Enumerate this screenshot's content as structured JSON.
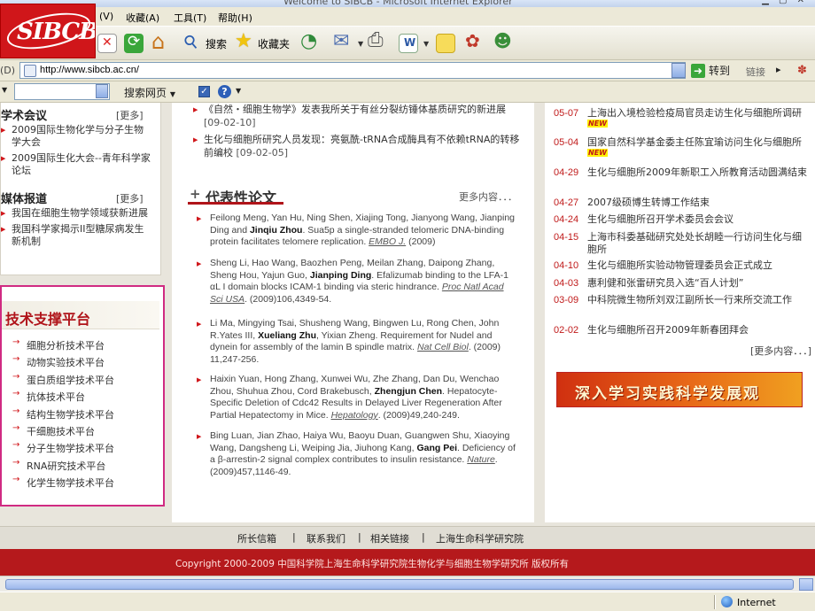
{
  "window": {
    "title": "Welcome to SIBCB - Microsoft Internet Explorer"
  },
  "logo": {
    "text": "SIBCB"
  },
  "menu": {
    "items": [
      "(V)",
      "收藏(A)",
      "工具(T)",
      "帮助(H)"
    ]
  },
  "toolbar": {
    "search_label": "搜索",
    "favorites_label": "收藏夹"
  },
  "address": {
    "label": "(D)",
    "url": "http://www.sibcb.ac.cn/",
    "go_label": "转到",
    "links_label": "链接"
  },
  "searchbar": {
    "search_web_label": "搜索网页"
  },
  "left": {
    "conf": {
      "title": "学术会议",
      "more": "[更多]",
      "items": [
        "2009国际生物化学与分子生物学大会",
        "2009国际生化大会--青年科学家论坛"
      ]
    },
    "media": {
      "title": "媒体报道",
      "more": "[更多]",
      "items": [
        "我国在细胞生物学领域获新进展",
        "我国科学家揭示II型糖尿病发生新机制"
      ]
    },
    "platform": {
      "title": "技术支撑平台",
      "items": [
        "细胞分析技术平台",
        "动物实验技术平台",
        "蛋白质组学技术平台",
        "抗体技术平台",
        "结构生物学技术平台",
        "干细胞技术平台",
        "分子生物学技术平台",
        "RNA研究技术平台",
        "化学生物学技术平台"
      ]
    }
  },
  "middle": {
    "news": [
      {
        "text": "《自然・细胞生物学》发表我所关于有丝分裂纺锤体基质研究的新进展",
        "date": "[09-02-10]"
      },
      {
        "text": "生化与细胞所研究人员发现：亮氨酰-tRNA合成酶具有不依赖tRNA的转移前编校",
        "date": "[09-02-05]"
      }
    ],
    "papers_title": "代表性论文",
    "papers_more": "更多内容．．．",
    "papers": [
      {
        "pre": "Feilong Meng, Yan Hu, Ning Shen, Xiajing Tong, Jianyong Wang, Jianping Ding and ",
        "bold": "Jinqiu Zhou",
        "post": ". Sua5p a single-stranded telomeric DNA-binding protein facilitates telomere replication. ",
        "journal": "EMBO J.",
        "tail": " (2009)"
      },
      {
        "pre": "Sheng Li, Hao Wang, Baozhen Peng, Meilan Zhang, Daipong Zhang, Sheng Hou, Yajun Guo, ",
        "bold": "Jianping Ding",
        "post": ". Efalizumab binding to the LFA-1 αL I domain blocks ICAM-1 binding via steric hindrance. ",
        "journal": "Proc Natl Acad Sci USA",
        "tail": ". (2009)106,4349-54."
      },
      {
        "pre": "Li Ma, Mingying Tsai, Shusheng Wang, Bingwen Lu, Rong Chen, John R.Yates III, ",
        "bold": "Xueliang Zhu",
        "post": ", Yixian Zheng. Requirement for Nudel and dynein for assembly of the lamin B spindle matrix. ",
        "journal": "Nat Cell Biol",
        "tail": ". (2009) 11,247-256."
      },
      {
        "pre": "Haixin Yuan, Hong Zhang, Xunwei Wu, Zhe Zhang, Dan Du, Wenchao Zhou, Shuhua Zhou, Cord Brakebusch, ",
        "bold": "Zhengjun Chen",
        "post": ". Hepatocyte-Specific Deletion of Cdc42 Results in Delayed Liver Regeneration After Partial Hepatectomy in Mice. ",
        "journal": "Hepatology",
        "tail": ". (2009)49,240-249."
      },
      {
        "pre": "Bing Luan, Jian Zhao, Haiya Wu, Baoyu Duan, Guangwen Shu, Xiaoying Wang, Dangsheng Li, Weiping Jia, Jiuhong Kang, ",
        "bold": "Gang Pei",
        "post": ". Deficiency of a β-arrestin-2 signal complex contributes to insulin resistance. ",
        "journal": "Nature",
        "tail": ". (2009)457,1146-49."
      }
    ]
  },
  "right": {
    "news": [
      {
        "date": "05-07",
        "text": "上海出入境检验检疫局官员走访生化与细胞所调研",
        "new": true
      },
      {
        "date": "05-04",
        "text": "国家自然科学基金委主任陈宜瑜访问生化与细胞所",
        "new": true
      },
      {
        "date": "04-29",
        "text": "生化与细胞所2009年新职工入所教育活动圆满结束",
        "new": false
      },
      {
        "date": "04-27",
        "text": "2007级硕博生转博工作结束",
        "new": false
      },
      {
        "date": "04-24",
        "text": "生化与细胞所召开学术委员会会议",
        "new": false
      },
      {
        "date": "04-15",
        "text": "上海市科委基础研究处处长胡睦一行访问生化与细胞所",
        "new": false
      },
      {
        "date": "04-10",
        "text": "生化与细胞所实验动物管理委员会正式成立",
        "new": false
      },
      {
        "date": "04-03",
        "text": "惠利健和张雷研究员入选“百人计划”",
        "new": false
      },
      {
        "date": "03-09",
        "text": "中科院微生物所刘双江副所长一行来所交流工作",
        "new": false
      },
      {
        "date": "02-02",
        "text": "生化与细胞所召开2009年新春团拜会",
        "new": false
      }
    ],
    "new_badge": "NEW",
    "more": "[更多内容．．．]",
    "banner": "深入学习实践科学发展观"
  },
  "footer": {
    "links": [
      "所长信箱",
      "|",
      "联系我们",
      "|",
      "相关链接",
      "|",
      "上海生命科学研究院"
    ],
    "copyright": "Copyright 2000-2009  中国科学院上海生命科学研究院生物化学与细胞生物学研究所  版权所有"
  },
  "status": {
    "zone": "Internet"
  }
}
